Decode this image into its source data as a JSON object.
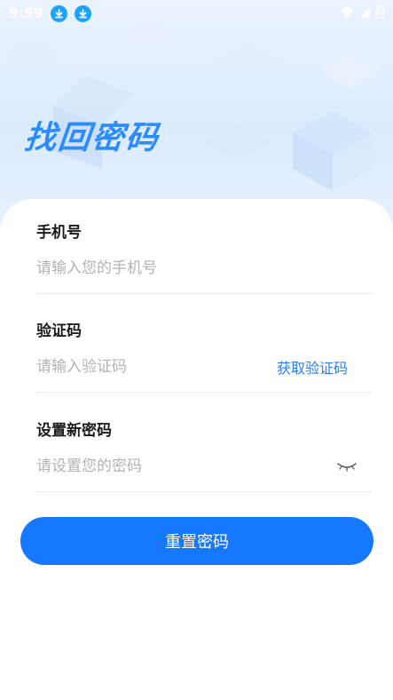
{
  "status_bar": {
    "time": "9:59"
  },
  "page": {
    "title": "找回密码"
  },
  "form": {
    "phone": {
      "label": "手机号",
      "placeholder": "请输入您的手机号"
    },
    "code": {
      "label": "验证码",
      "placeholder": "请输入验证码",
      "get_code": "获取验证码"
    },
    "password": {
      "label": "设置新密码",
      "placeholder": "请设置您的密码"
    },
    "submit_label": "重置密码"
  },
  "colors": {
    "accent": "#1677ff",
    "title": "#2a8cff",
    "link": "#2a7df7",
    "status_icon": "#1aa3ff"
  },
  "icons": [
    "download-icon",
    "download-icon",
    "wifi-icon",
    "signal-icon",
    "battery-icon",
    "eye-closed-icon"
  ]
}
